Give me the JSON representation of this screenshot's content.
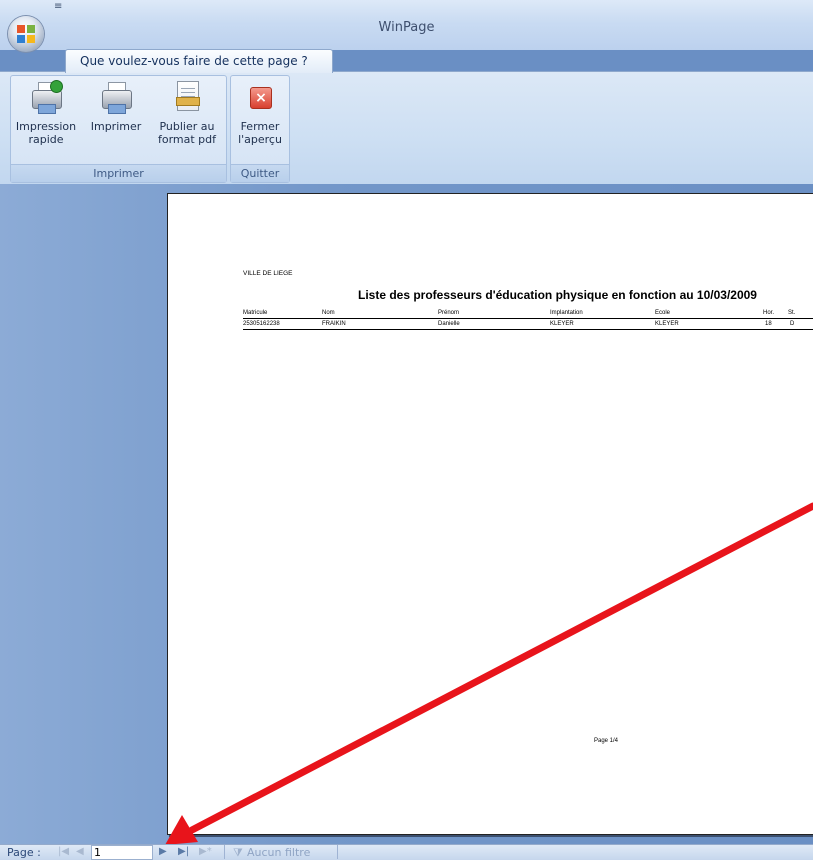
{
  "window": {
    "title": "WinPage",
    "quick_access_arrow": "≡"
  },
  "ribbon": {
    "tab_label": "Que voulez-vous faire de cette page ?",
    "groups": [
      {
        "label": "Imprimer",
        "buttons": [
          {
            "line1": "Impression",
            "line2": "rapide",
            "icon": "quick-print-icon"
          },
          {
            "line1": "Imprimer",
            "line2": "",
            "icon": "print-icon"
          },
          {
            "line1": "Publier au",
            "line2": "format pdf",
            "icon": "pdf-icon"
          }
        ]
      },
      {
        "label": "Quitter",
        "buttons": [
          {
            "line1": "Fermer",
            "line2": "l'aperçu",
            "icon": "close-preview-icon"
          }
        ]
      }
    ]
  },
  "report": {
    "org": "VILLE DE LIEGE",
    "title": "Liste des professeurs d'éducation physique en fonction au 10/03/2009",
    "columns": [
      "Matricule",
      "Nom",
      "Prénom",
      "Implantation",
      "Ecole",
      "Hor.",
      "St."
    ],
    "rows": [
      [
        "25305162238",
        "FRAIKIN",
        "Danielle",
        "KLEYER",
        "KLEYER",
        "18",
        "D"
      ]
    ],
    "footer": "Page 1/4"
  },
  "status": {
    "page_label": "Page :",
    "page_value": "1",
    "first_glyph": "|◀",
    "prev_glyph": "◀",
    "next_glyph": "▶",
    "last_glyph": "▶|",
    "new_glyph": "▶*",
    "filter_label": "Aucun filtre"
  },
  "annotation": {
    "arrow_color": "#e8141b"
  }
}
